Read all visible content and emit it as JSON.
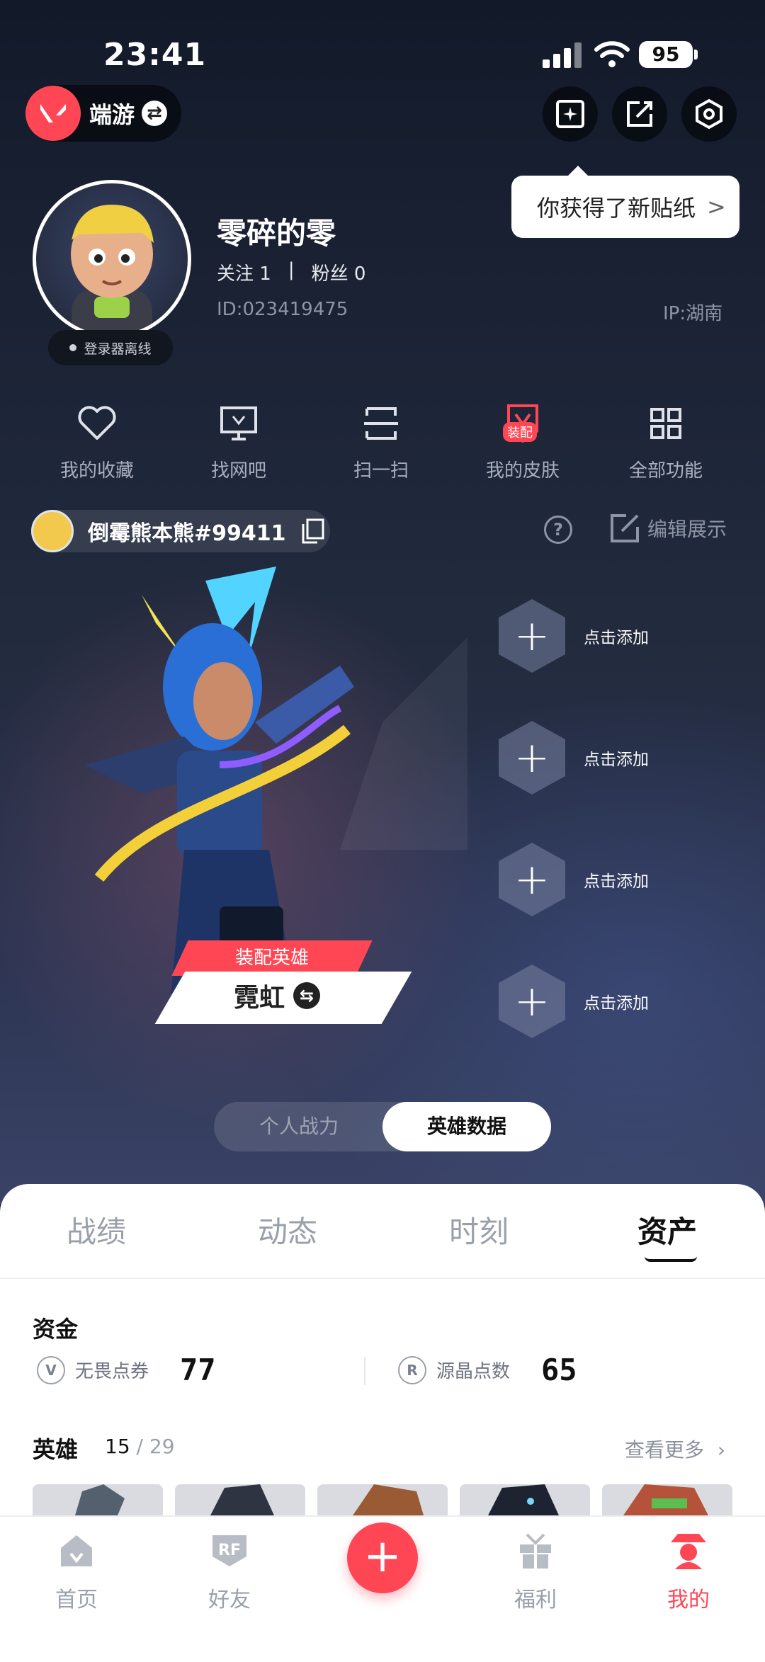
{
  "status_bar": {
    "time": "23:41",
    "battery": "95"
  },
  "app_switcher": {
    "name": "端游"
  },
  "sticker_tip": {
    "text": "你获得了新贴纸",
    "arrow": ">"
  },
  "profile": {
    "username": "零碎的零",
    "follow_label": "关注 1",
    "separator": "|",
    "fans_label": "粉丝 0",
    "id": "ID:023419475",
    "ip": "IP:湖南",
    "offline_status": "登录器离线"
  },
  "quick_actions": [
    {
      "label": "我的收藏",
      "icon": "heart-icon"
    },
    {
      "label": "找网吧",
      "icon": "monitor-icon"
    },
    {
      "label": "扫一扫",
      "icon": "scan-icon"
    },
    {
      "label": "我的皮肤",
      "icon": "skin-icon",
      "badge": "装配"
    },
    {
      "label": "全部功能",
      "icon": "grid-icon"
    }
  ],
  "game_account": {
    "name": "倒霉熊本熊#99411"
  },
  "edit_display": "编辑展示",
  "hero_card": {
    "tag": "装配英雄",
    "name": "霓虹"
  },
  "slots": [
    "点击添加",
    "点击添加",
    "点击添加",
    "点击添加"
  ],
  "segmented": {
    "option_a": "个人战力",
    "option_b": "英雄数据",
    "selected": "英雄数据"
  },
  "tabs": [
    "战绩",
    "动态",
    "时刻",
    "资产"
  ],
  "active_tab": "资产",
  "funds": {
    "title": "资金",
    "items": [
      {
        "label": "无畏点券",
        "value": "77",
        "icon": "valorant-points-icon"
      },
      {
        "label": "源晶点数",
        "value": "65",
        "icon": "radianite-icon"
      }
    ]
  },
  "heroes": {
    "title": "英雄",
    "owned": "15",
    "total": "/ 29",
    "more": "查看更多"
  },
  "bottom_nav": [
    {
      "label": "首页",
      "icon": "home-icon"
    },
    {
      "label": "好友",
      "icon": "friends-icon"
    },
    {
      "label": "福利",
      "icon": "gift-icon"
    },
    {
      "label": "我的",
      "icon": "me-icon",
      "active": true
    }
  ],
  "colors": {
    "accent": "#ff4655",
    "sheet_bg": "#ffffff",
    "header_bg": "#1a2234"
  }
}
